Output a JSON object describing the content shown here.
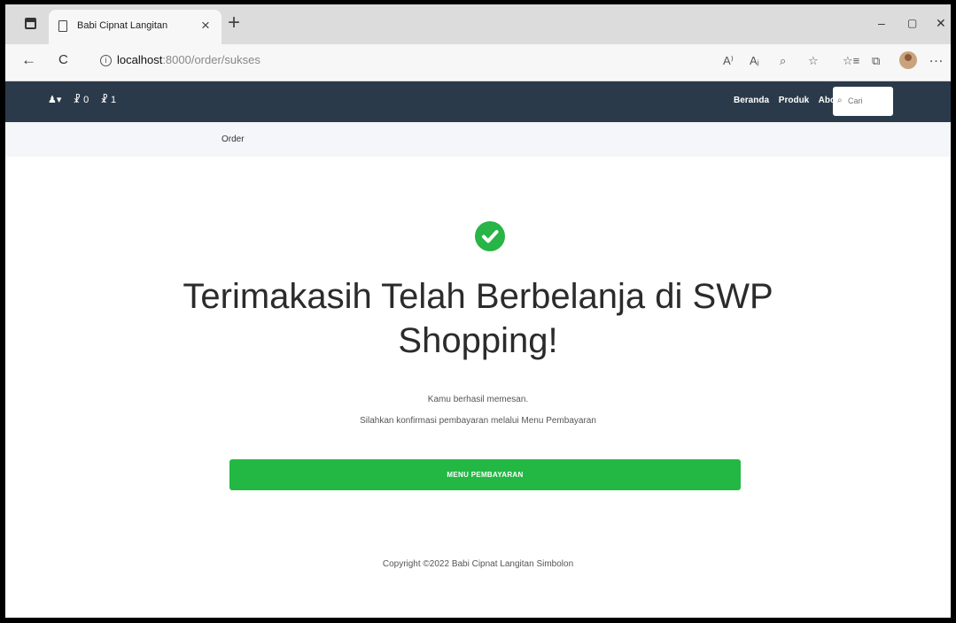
{
  "browser": {
    "tab_title": "Babi Cipnat Langitan",
    "tab_close": "×",
    "new_tab": "+",
    "window": {
      "minimize": "–",
      "maximize": "▢",
      "close": "✕"
    },
    "url_host": "localhost",
    "url_path": ":8000/order/sukses"
  },
  "icons": {
    "back": "←",
    "refresh": "C",
    "read_aloud": "A⁾",
    "immersive": "Aⱼ",
    "zoom": "⌕",
    "extensions": "☆",
    "favorites": "☆≡",
    "collections": "⧉",
    "more": "…",
    "user": "♣",
    "cart": "₱"
  },
  "sitenav": {
    "user_menu": "♟▾",
    "cart_a": "☧ 0",
    "cart_b": "☧ 1",
    "links": [
      "Beranda",
      "Produk",
      "About Us"
    ],
    "search_placeholder": "Cari"
  },
  "breadcrumb": {
    "current": "Order"
  },
  "main": {
    "headline_line1": "Terimakasih Telah Berbelanja di SWP",
    "headline_line2": "Shopping!",
    "sub1": "Kamu berhasil memesan.",
    "sub2": "Silahkan konfirmasi pembayaran melalui Menu Pembayaran",
    "button": "MENU PEMBAYARAN"
  },
  "footer": {
    "copyright": "Copyright ©2022 Babi Cipnat Langitan Simbolon"
  },
  "colors": {
    "nav_bg": "#2b3a4a",
    "accent_green": "#22b843",
    "crumb_bg": "#f4f6f9"
  }
}
